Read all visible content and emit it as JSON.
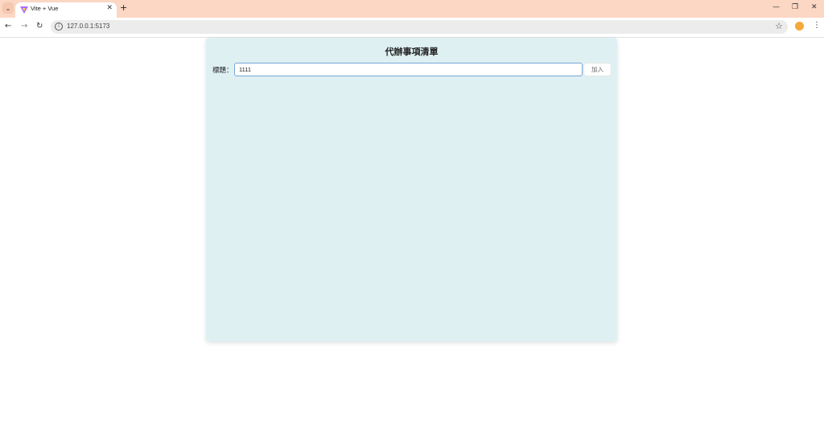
{
  "browser": {
    "tab": {
      "title": "Vite + Vue"
    },
    "new_tab_symbol": "+",
    "url": "127.0.0.1:5173"
  },
  "app": {
    "title": "代辦事項清單",
    "input_label": "標題：",
    "input_value": "1111",
    "add_button": "加入"
  },
  "colors": {
    "tabstrip": "#fbd7c4",
    "card": "#dff0f2",
    "input_border": "#7aa6d6"
  }
}
